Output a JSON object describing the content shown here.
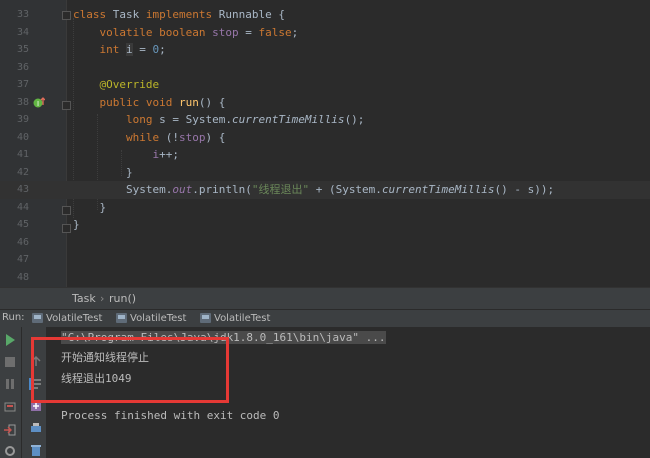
{
  "editor": {
    "lines": [
      {
        "n": "33",
        "parts": [
          [
            "k",
            "class "
          ],
          [
            "",
            "Task "
          ],
          [
            "k",
            "implements "
          ],
          [
            "",
            "Runnable {"
          ]
        ]
      },
      {
        "n": "34",
        "parts": [
          [
            "",
            "    "
          ],
          [
            "k",
            "volatile boolean "
          ],
          [
            "f",
            "stop"
          ],
          [
            "",
            " = "
          ],
          [
            "k",
            "false"
          ],
          [
            "",
            ";"
          ]
        ]
      },
      {
        "n": "35",
        "parts": [
          [
            "",
            "    "
          ],
          [
            "k",
            "int "
          ],
          [
            "caret",
            "i"
          ],
          [
            "f",
            ""
          ],
          [
            "",
            " = "
          ],
          [
            "n",
            "0"
          ],
          [
            "",
            ";"
          ]
        ]
      },
      {
        "n": "36",
        "parts": []
      },
      {
        "n": "37",
        "parts": [
          [
            "",
            "    "
          ],
          [
            "a",
            "@Override"
          ]
        ]
      },
      {
        "n": "38",
        "parts": [
          [
            "",
            "    "
          ],
          [
            "k",
            "public void "
          ],
          [
            "fn",
            "run"
          ],
          [
            "",
            "() {"
          ]
        ]
      },
      {
        "n": "39",
        "parts": [
          [
            "",
            "        "
          ],
          [
            "k",
            "long "
          ],
          [
            "",
            "s = System."
          ],
          [
            "it",
            "currentTimeMillis"
          ],
          [
            "",
            "();"
          ]
        ]
      },
      {
        "n": "40",
        "parts": [
          [
            "",
            "        "
          ],
          [
            "k",
            "while "
          ],
          [
            "",
            "(!"
          ],
          [
            "f",
            "stop"
          ],
          [
            "",
            ") {"
          ]
        ]
      },
      {
        "n": "41",
        "parts": [
          [
            "",
            "            "
          ],
          [
            "f",
            "i"
          ],
          [
            "",
            "++;"
          ]
        ]
      },
      {
        "n": "42",
        "parts": [
          [
            "",
            "        }"
          ]
        ]
      },
      {
        "n": "43",
        "parts": [
          [
            "",
            "        System."
          ],
          [
            "m",
            "out"
          ],
          [
            "",
            ".println("
          ],
          [
            "s",
            "\"线程退出\""
          ],
          [
            "",
            " + (System."
          ],
          [
            "it",
            "currentTimeMillis"
          ],
          [
            "",
            "() - s));"
          ]
        ]
      },
      {
        "n": "44",
        "parts": [
          [
            "",
            "    }"
          ]
        ]
      },
      {
        "n": "45",
        "parts": [
          [
            "",
            "}"
          ]
        ]
      },
      {
        "n": "46",
        "parts": []
      },
      {
        "n": "47",
        "parts": []
      },
      {
        "n": "48",
        "parts": []
      }
    ]
  },
  "breadcrumb": {
    "class_name": "Task",
    "separator": "›",
    "method": "run()"
  },
  "run_panel": {
    "label": "Run:",
    "tabs": [
      "VolatileTest",
      "VolatileTest",
      "VolatileTest"
    ]
  },
  "console": {
    "command": "\"C:\\Program Files\\Java\\jdk1.8.0_161\\bin\\java\" ...",
    "output_1": "开始通知线程停止",
    "output_2": "线程退出1049",
    "exit": "Process finished with exit code 0"
  },
  "colors": {
    "annotation_box": "#e53935",
    "run_green": "#59a869"
  }
}
